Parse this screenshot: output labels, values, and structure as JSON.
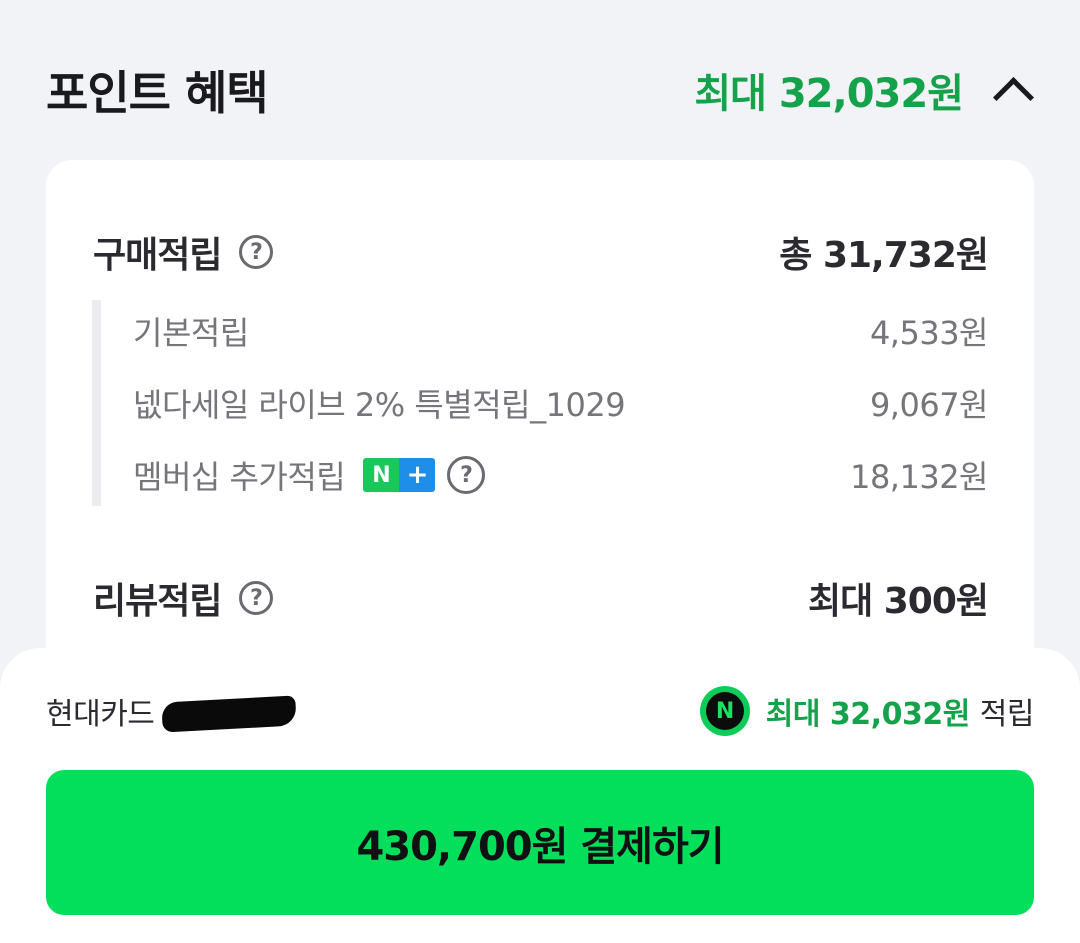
{
  "header": {
    "title": "포인트 혜택",
    "max_total": "최대 32,032원",
    "toggle_icon": "chevron-up-icon"
  },
  "purchase_reward": {
    "title": "구매적립",
    "total": "총 31,732원",
    "items": [
      {
        "label": "기본적립",
        "value": "4,533원"
      },
      {
        "label": "넶다세일 라이브 2% 특별적립_1029",
        "value": "9,067원"
      },
      {
        "label": "멤버십 추가적립",
        "value": "18,132원",
        "badge_n": "N",
        "badge_plus": "+"
      }
    ]
  },
  "review_reward": {
    "title": "리뷰적립",
    "value": "최대 300원"
  },
  "help_icon_glyph": "?",
  "payment": {
    "card_name": "현대카드",
    "npay_glyph": "N",
    "reward_max": "최대 32,032원",
    "reward_suffix": "적립",
    "button_label": "430,700원 결제하기"
  },
  "colors": {
    "accent_green": "#14a34a",
    "pay_button": "#03de5b",
    "background": "#f2f3f6"
  }
}
